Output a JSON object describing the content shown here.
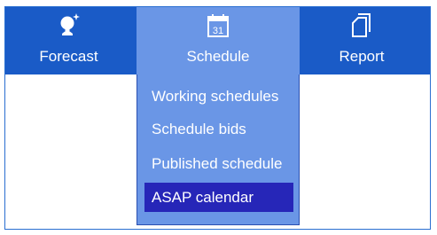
{
  "nav": {
    "items": [
      {
        "label": "Forecast",
        "icon": "forecast-icon"
      },
      {
        "label": "Schedule",
        "icon": "calendar-icon",
        "icon_text": "31"
      },
      {
        "label": "Report",
        "icon": "report-icon"
      }
    ]
  },
  "dropdown": {
    "items": [
      {
        "label": "Working schedules"
      },
      {
        "label": "Schedule bids"
      },
      {
        "label": "Published schedule"
      },
      {
        "label": "ASAP calendar",
        "selected": true
      }
    ]
  },
  "colors": {
    "navbar": "#1a5bc7",
    "active_tab": "#6a96e6",
    "selected_item": "#2626b8",
    "text": "#ffffff"
  }
}
